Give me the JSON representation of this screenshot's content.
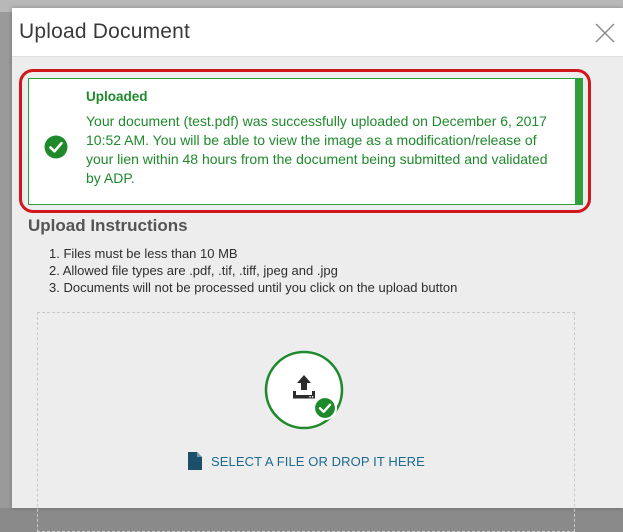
{
  "modal": {
    "title": "Upload Document",
    "close_icon": "close-icon"
  },
  "alert": {
    "title": "Uploaded",
    "message": "Your document (test.pdf) was successfully uploaded on December 6, 2017 10:52 AM.  You will be able to view the image as a modification/release of your lien within 48 hours from the document being submitted and validated by ADP.",
    "icon": "check-circle-icon",
    "color": "#2e9e3a",
    "highlight_color": "#d0171b"
  },
  "instructions": {
    "title": "Upload Instructions",
    "items": [
      "1. Files must be less than 10 MB",
      "2. Allowed file types are .pdf, .tif, .tiff, jpeg and .jpg",
      "3. Documents will not be processed until you click on the upload button"
    ]
  },
  "dropzone": {
    "icon": "upload-icon",
    "status_icon": "check-circle-icon",
    "file_icon": "file-icon",
    "select_label": "SELECT A FILE OR DROP IT HERE"
  }
}
